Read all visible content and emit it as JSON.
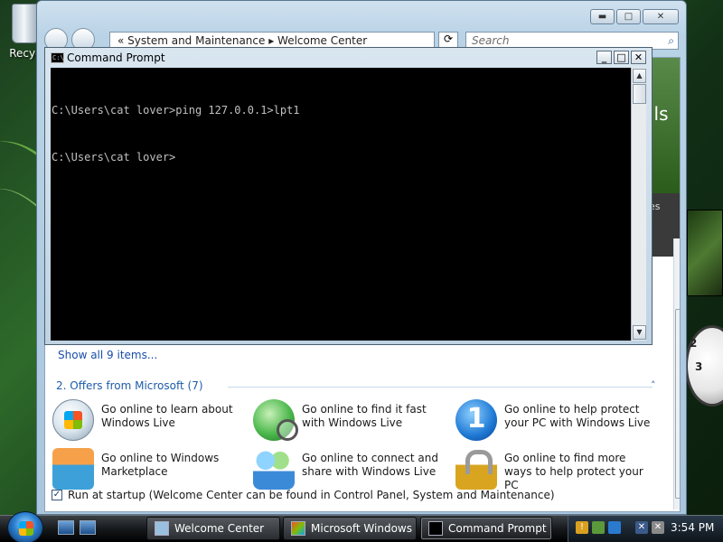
{
  "desktop": {
    "recycle_label": "Recyc"
  },
  "welcome_center": {
    "address_path": "« System and Maintenance ▸ Welcome Center",
    "search_placeholder": "Search",
    "sidebar_fragment_1": "ils",
    "sidebar_fragment_2": "es",
    "sidebar_fragment_3": "e",
    "show_all_link": "Show all 9 items...",
    "section_title": "2. Offers from Microsoft (7)",
    "offers": [
      {
        "icon": "windows-live-icon",
        "text": "Go online to learn about Windows Live"
      },
      {
        "icon": "globe-search-icon",
        "text": "Go online to find it fast with Windows Live"
      },
      {
        "icon": "onecare-icon",
        "text": "Go online to help protect your PC with Windows Live"
      },
      {
        "icon": "marketplace-basket-icon",
        "text": "Go online to Windows Marketplace"
      },
      {
        "icon": "messenger-people-icon",
        "text": "Go online to connect and share with Windows Live"
      },
      {
        "icon": "padlock-icon",
        "text": "Go online to find more ways to help protect your PC"
      }
    ],
    "startup_checkbox_checked": true,
    "startup_label": "Run at startup (Welcome Center can be found in Control Panel, System and Maintenance)"
  },
  "command_prompt": {
    "title": "Command Prompt",
    "icon_text": "C:\\",
    "lines": [
      "C:\\Users\\cat lover>ping 127.0.0.1>lpt1",
      "C:\\Users\\cat lover>"
    ]
  },
  "clock_numbers": {
    "three": "3",
    "two": "2"
  },
  "taskbar": {
    "buttons": [
      {
        "label": "Welcome Center"
      },
      {
        "label": "Microsoft Windows"
      },
      {
        "label": "Command Prompt"
      }
    ],
    "time": "3:54 PM"
  },
  "colors": {
    "console_bg": "#000000",
    "console_text": "#c0c0c0",
    "link": "#1a4da8",
    "section_title": "#1d5ca8"
  }
}
